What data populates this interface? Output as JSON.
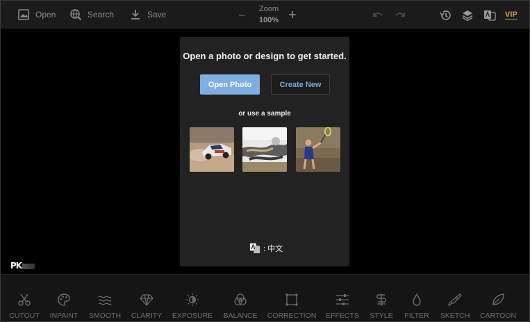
{
  "toolbar": {
    "open_label": "Open",
    "search_label": "Search",
    "save_label": "Save",
    "zoom_label": "Zoom",
    "zoom_value": "100%",
    "zoom_minus": "−",
    "zoom_plus": "+",
    "vip_label": "VIP",
    "icons": [
      "image-icon",
      "search-globe-icon",
      "download-icon",
      "undo-icon",
      "redo-icon",
      "history-icon",
      "layers-icon",
      "translate-icon"
    ]
  },
  "dialog": {
    "title": "Open a photo or design to get started.",
    "open_photo_label": "Open Photo",
    "create_new_label": "Create New",
    "sample_label": "or use a sample",
    "samples": [
      "rally-car-photo",
      "metal-tools-photo",
      "tennis-player-photo"
    ],
    "language_label": ": 中文"
  },
  "logo": {
    "text": "PK"
  },
  "tools": [
    {
      "label": "CUTOUT",
      "icon": "scissors-icon"
    },
    {
      "label": "INPAINT",
      "icon": "palette-icon"
    },
    {
      "label": "SMOOTH",
      "icon": "waves-icon"
    },
    {
      "label": "CLARITY",
      "icon": "diamond-icon"
    },
    {
      "label": "EXPOSURE",
      "icon": "sun-icon"
    },
    {
      "label": "BALANCE",
      "icon": "circles-icon"
    },
    {
      "label": "CORRECTION",
      "icon": "crop-frame-icon"
    },
    {
      "label": "EFFECTS",
      "icon": "sliders-icon"
    },
    {
      "label": "STYLE",
      "icon": "style-icon"
    },
    {
      "label": "FILTER",
      "icon": "drop-icon"
    },
    {
      "label": "SKETCH",
      "icon": "brush-icon"
    },
    {
      "label": "CARTOON",
      "icon": "leaf-icon"
    }
  ],
  "colors": {
    "accent": "#7faee0",
    "create_new_text": "#7aa8d8",
    "vip": "#c9a24c",
    "panel": "#222222",
    "toolbar": "#1b1b1b"
  }
}
